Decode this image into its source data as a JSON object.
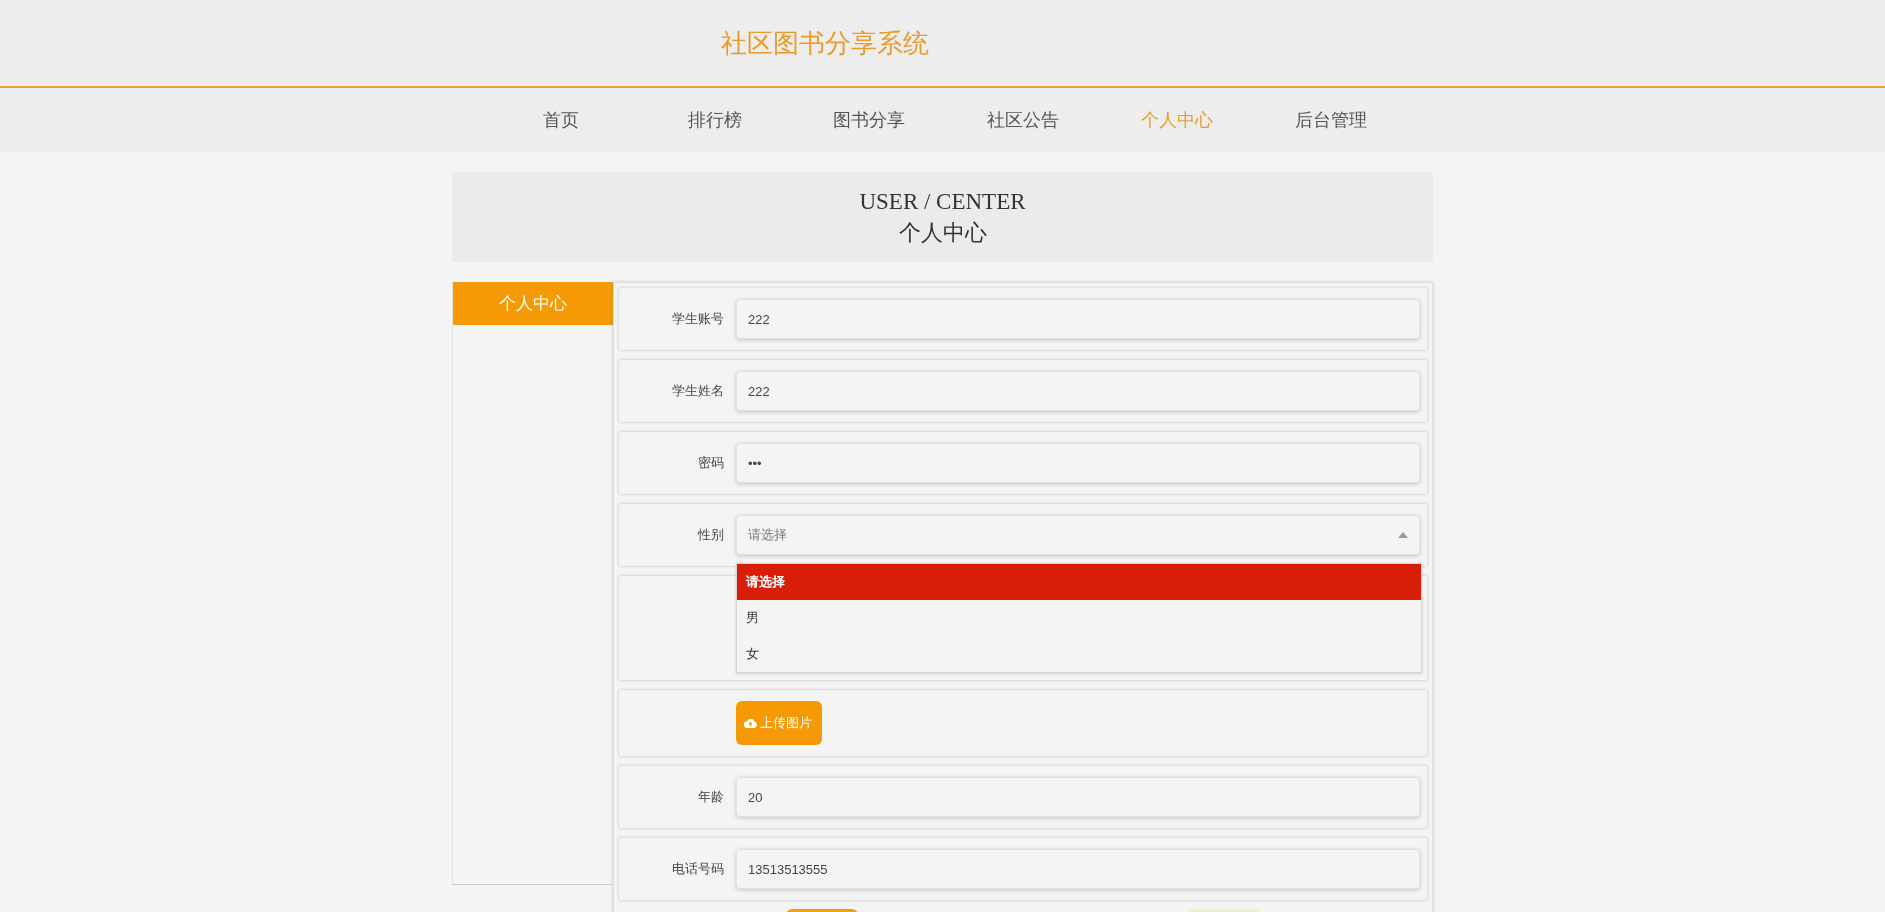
{
  "site_title": "社区图书分享系统",
  "nav": [
    {
      "label": "首页",
      "selected": false
    },
    {
      "label": "排行榜",
      "selected": false
    },
    {
      "label": "图书分享",
      "selected": false
    },
    {
      "label": "社区公告",
      "selected": false
    },
    {
      "label": "个人中心",
      "selected": true
    },
    {
      "label": "后台管理",
      "selected": false
    }
  ],
  "banner": {
    "title_en": "USER / CENTER",
    "title": "个人中心"
  },
  "sidebar": {
    "items": [
      {
        "label": "个人中心",
        "selected": true
      }
    ]
  },
  "form": {
    "rows": [
      {
        "kind": "text",
        "label": "学生账号",
        "value": "222"
      },
      {
        "kind": "text",
        "label": "学生姓名",
        "value": "222"
      },
      {
        "kind": "text",
        "label": "密码",
        "value": "•••"
      },
      {
        "kind": "select",
        "label": "性别",
        "placeholder": "请选择",
        "expanded": true,
        "options": [
          {
            "label": "请选择",
            "selected": true
          },
          {
            "label": "男",
            "selected": false
          },
          {
            "label": "女",
            "selected": false
          }
        ]
      },
      {
        "kind": "blank"
      },
      {
        "kind": "upload",
        "button": "上传图片"
      },
      {
        "kind": "text",
        "label": "年龄",
        "value": "20"
      },
      {
        "kind": "text",
        "label": "电话号码",
        "value": "13513513555"
      }
    ],
    "buttons": [
      {
        "kind": "primary"
      },
      {
        "kind": "secondary"
      }
    ]
  }
}
